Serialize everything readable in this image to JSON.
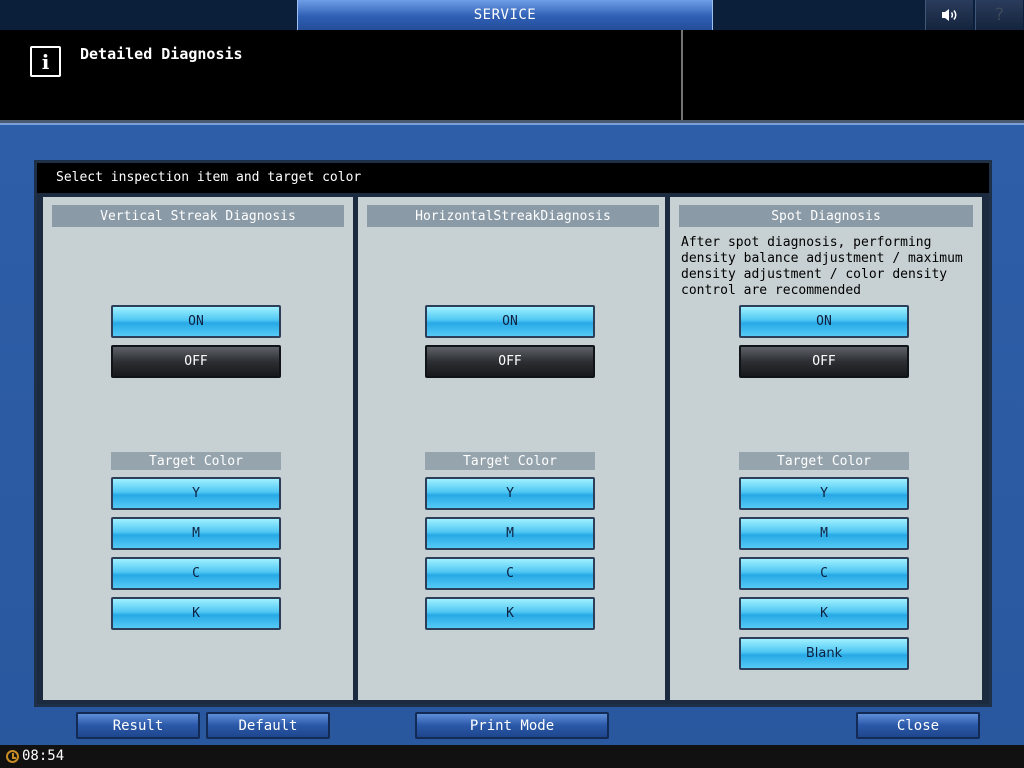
{
  "topbar": {
    "title": "SERVICE",
    "help_label": "?"
  },
  "header": {
    "info_icon_label": "i",
    "title": "Detailed Diagnosis"
  },
  "instruction": "Select inspection item and target color",
  "columns": [
    {
      "title": "Vertical Streak Diagnosis",
      "on_label": "ON",
      "off_label": "OFF",
      "target_color_label": "Target Color",
      "colors": [
        "Y",
        "M",
        "C",
        "K"
      ]
    },
    {
      "title": "HorizontalStreakDiagnosis",
      "on_label": "ON",
      "off_label": "OFF",
      "target_color_label": "Target Color",
      "colors": [
        "Y",
        "M",
        "C",
        "K"
      ]
    },
    {
      "title": "Spot Diagnosis",
      "description": "After spot diagnosis, performing density balance adjustment / maximum density adjustment / color density control are recommended",
      "on_label": "ON",
      "off_label": "OFF",
      "target_color_label": "Target Color",
      "colors": [
        "Y",
        "M",
        "C",
        "K",
        "Blank"
      ]
    }
  ],
  "footer": {
    "result": "Result",
    "default": "Default",
    "print_mode": "Print Mode",
    "close": "Close"
  },
  "status": {
    "time": "08:54"
  },
  "colors": {
    "accent_blue": "#2e5ea8",
    "button_on": "#4fc7f3",
    "button_off": "#2c2f33"
  }
}
